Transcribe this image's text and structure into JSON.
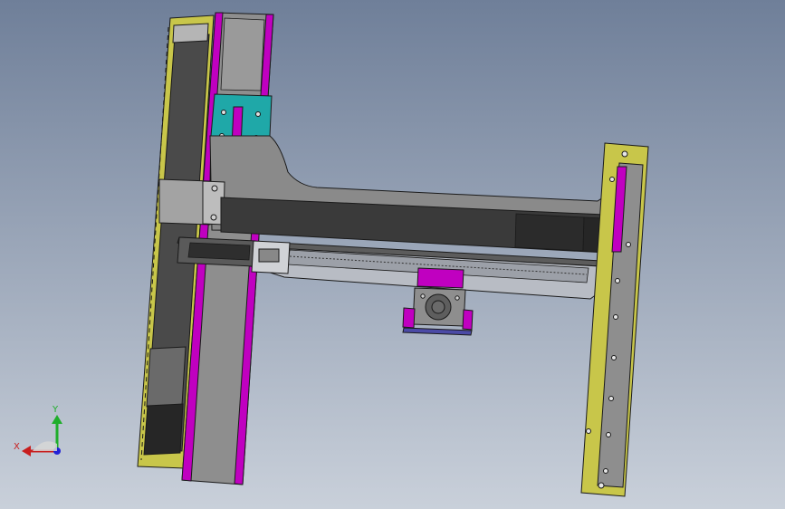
{
  "viewport": {
    "background_top": "#6f7f99",
    "background_bottom": "#c9d0da"
  },
  "colors": {
    "outline": "#1a1a1a",
    "rail_yellow": "#c8c64a",
    "rail_gray": "#8e8e8e",
    "rail_dark": "#4a4a4a",
    "accent_magenta": "#c000c0",
    "accent_teal": "#1fa8a8",
    "beam_gray": "#8a8a8a",
    "beam_dark": "#3a3a3a",
    "carriage_silver": "#b8bcc4",
    "motor_purple": "#4b4aa6"
  },
  "triad": {
    "x_label": "X",
    "y_label": "Y",
    "x_color": "#c81e1e",
    "y_color": "#1fae2b",
    "z_color": "#2121d6"
  }
}
